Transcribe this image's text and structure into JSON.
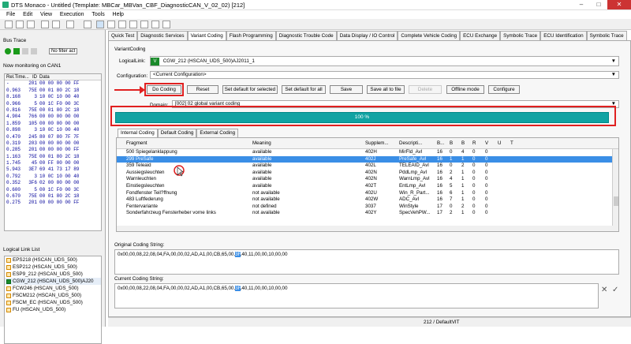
{
  "window": {
    "title": "DTS Monaco - Untitled (Template: MBCar_MBVan_CBF_DiagnosticCAN_V_02_02) [212]"
  },
  "menu": [
    "File",
    "Edit",
    "View",
    "Execution",
    "Tools",
    "Help"
  ],
  "bus_trace": {
    "title": "Bus Trace",
    "filter_label": "No filter act",
    "monitoring": "Now monitoring on CAN1",
    "columns": [
      "Rel.Time...",
      "ID",
      "Data"
    ],
    "rows": [
      [
        "-",
        "201",
        "00 00 00 00 FF"
      ],
      [
        "0.963",
        "75E",
        "00 01 80 2C 18"
      ],
      [
        "8.168",
        "3",
        "10 0C 10 00 40"
      ],
      [
        "0.966",
        "5",
        "00 1C F0 00 3C"
      ],
      [
        "0.816",
        "75E",
        "00 01 80 2C 18"
      ],
      [
        "4.904",
        "766",
        "00 00 00 00 00"
      ],
      [
        "1.859",
        "105",
        "00 00 00 00 00"
      ],
      [
        "0.898",
        "3",
        "10 0C 10 00 40"
      ],
      [
        "0.470",
        "245",
        "80 07 80 7F 7F"
      ],
      [
        "0.319",
        "203",
        "00 00 00 00 00"
      ],
      [
        "0.285",
        "201",
        "00 00 00 00 FF"
      ],
      [
        "1.163",
        "75E",
        "00 01 80 2C 18"
      ],
      [
        "1.745",
        "45",
        "00 FF 00 00 00"
      ],
      [
        "5.943",
        "3E7",
        "69 41 73 17 89"
      ],
      [
        "0.792",
        "3",
        "10 0C 10 00 40"
      ],
      [
        "0.352",
        "3F6",
        "02 00 00 00 00"
      ],
      [
        "0.600",
        "5",
        "00 1C F0 00 3C"
      ],
      [
        "0.670",
        "75E",
        "00 01 80 2C 18"
      ],
      [
        "0.275",
        "201",
        "00 00 00 00 FF"
      ]
    ]
  },
  "logical_link_list": {
    "title": "Logical Link List",
    "items": [
      "EPS218 (HSCAN_UDS_500)",
      "ESP212 (HSCAN_UDS_500)",
      "ESP9_212 (HSCAN_UDS_500)",
      "CGW_212 (HSCAN_UDS_500)AJ20",
      "FCW246 (HSCAN_UDS_500)",
      "FSCM212 (HSCAN_UDS_500)",
      "FSCM_EC (HSCAN_UDS_500)",
      "FU (HSCAN_UDS_500)"
    ]
  },
  "tabs": [
    "Quick Test",
    "Diagnostic Services",
    "Variant Coding",
    "Flash Programming",
    "Diagnostic Trouble Code",
    "Data Display / IO Control",
    "Complete Vehicle Coding",
    "ECU Exchange",
    "Symbolic Trace",
    "ECU Identification",
    "Symbolic Trace"
  ],
  "variant_coding": {
    "group_label": "VariantCoding",
    "logical_link_label": "LogicalLink:",
    "logical_link_value": "CGW_212 (HSCAN_UDS_500)AJ2011_1",
    "configuration_label": "Configuration:",
    "configuration_value": "<Current Configuration>",
    "buttons": [
      "Do Coding",
      "Reset",
      "Set default for selected",
      "Set default for all",
      "Save",
      "Save all to file",
      "Delete",
      "Offline mode",
      "Configure"
    ],
    "domain_label": "Domain:",
    "domain_value": "[002] 02 global variant coding",
    "progress_text": "100 %",
    "progress": 1.0,
    "subtabs": [
      "Internal Coding",
      "Default Coding",
      "External Coding"
    ],
    "columns": [
      "Fragment",
      "Meaning",
      "Supplem...",
      "Descripti...",
      "B...",
      "B",
      "B",
      "R",
      "V",
      "U",
      "T"
    ],
    "rows": [
      [
        "500 Spiegelanklappung",
        "available",
        "402H",
        "MirFld_Avl",
        "16",
        "0",
        "4",
        "0",
        "0",
        "",
        ""
      ],
      [
        "299 PreSafe",
        "available",
        "402J",
        "PreSafe_Avl",
        "16",
        "1",
        "1",
        "0",
        "0",
        "",
        ""
      ],
      [
        "359 Teleaid",
        "available",
        "402L",
        "TELEAID_Avl",
        "16",
        "0",
        "2",
        "0",
        "0",
        "",
        ""
      ],
      [
        "Aussiegsleuchten",
        "available",
        "402N",
        "PddLmp_Avl",
        "16",
        "2",
        "1",
        "0",
        "0",
        "",
        ""
      ],
      [
        "Warnleuchten",
        "available",
        "402N",
        "WarnLmp_Avl",
        "16",
        "4",
        "1",
        "0",
        "0",
        "",
        ""
      ],
      [
        "Einstiegsleuchten",
        "available",
        "402T",
        "EntLmp_Avl",
        "16",
        "5",
        "1",
        "0",
        "0",
        "",
        ""
      ],
      [
        "Fondfenster Teil?ffnung",
        "not available",
        "402U",
        "Win_R_Part...",
        "16",
        "6",
        "1",
        "0",
        "0",
        "",
        ""
      ],
      [
        "483 Luftfederung",
        "not available",
        "402W",
        "ADC_Avl",
        "16",
        "7",
        "1",
        "0",
        "0",
        "",
        ""
      ],
      [
        "Fentervariante",
        "not defined",
        "3037",
        "WinStyle",
        "17",
        "0",
        "2",
        "0",
        "0",
        "",
        ""
      ],
      [
        "Sonderfahrzeug Fensterheber vorne links",
        "not available",
        "402Y",
        "SpecVehPW...",
        "17",
        "2",
        "1",
        "0",
        "0",
        "",
        ""
      ]
    ],
    "selected_row": 1,
    "original_label": "Original Coding String:",
    "original_string_before": "0x00,00,08,22,08,04,FA,00,00,02,AD,A1,00,CB,65,00,",
    "original_string_hl": "3F",
    "original_string_after": ",40,11,00,00,10,00,00",
    "current_label": "Current Coding String:",
    "current_string_before": "0x00,00,08,22,08,04,FA,00,00,02,AD,A1,00,CB,65,00,",
    "current_string_hl": "3F",
    "current_string_after": ",40,11,00,00,10,00,00"
  },
  "status": {
    "text": "212 / DefaultVIT"
  },
  "colors": {
    "progress": "#11a3a3",
    "highlight": "#e02020",
    "selection": "#3a8ee6"
  }
}
